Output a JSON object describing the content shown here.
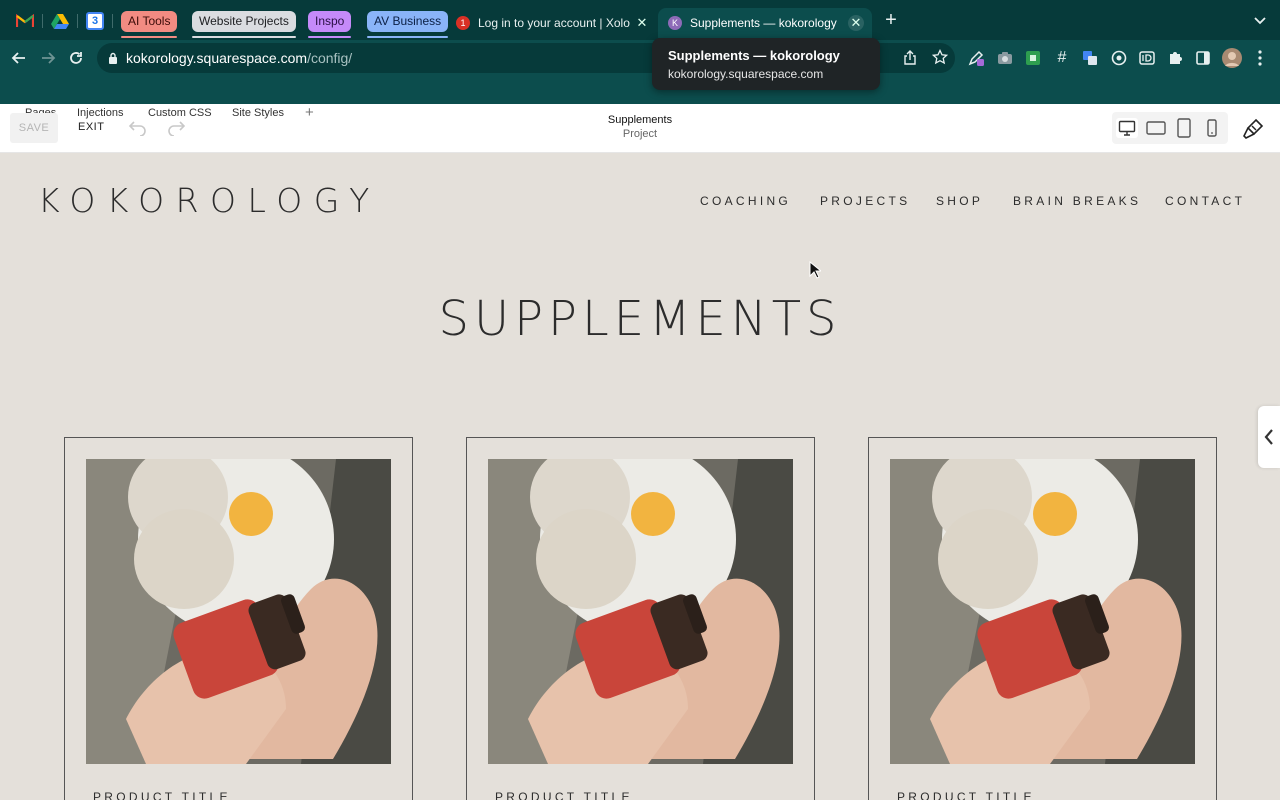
{
  "browser": {
    "pinned_tabs": [
      {
        "name": "gmail-icon",
        "glyph": "M",
        "color": "#ea4335"
      },
      {
        "name": "drive-icon",
        "glyph": "▲",
        "color": "#1fa463"
      },
      {
        "name": "calendar-icon",
        "glyph": "3",
        "color": "#4285f4"
      }
    ],
    "tab_groups": [
      {
        "label": "AI Tools",
        "color": "#f28b82",
        "text": "#3b0b08"
      },
      {
        "label": "Website Projects",
        "color": "#dadce0",
        "text": "#202124"
      },
      {
        "label": "Inspo",
        "color": "#c58af9",
        "text": "#2a0f44"
      },
      {
        "label": "AV Business",
        "color": "#8ab4f8",
        "text": "#0b1f44"
      }
    ],
    "tabs": [
      {
        "title": "Log in to your account | Xolo",
        "badge": "1"
      },
      {
        "title": "Supplements — kokorology",
        "active": true
      }
    ],
    "url_host": "kokorology.squarespace.com",
    "url_path": "/config/",
    "tooltip": {
      "title": "Supplements — kokorology",
      "host": "kokorology.squarespace.com"
    }
  },
  "editor": {
    "menu": [
      "Pages",
      "Injections",
      "Custom CSS",
      "Site Styles"
    ],
    "add_label": "+",
    "save_label": "SAVE",
    "exit_label": "EXIT",
    "page_name": "Supplements",
    "page_type": "Project"
  },
  "site": {
    "logo": "KOKOROLOGY",
    "nav": [
      "COACHING",
      "PROJECTS",
      "SHOP",
      "BRAIN BREAKS",
      "CONTACT"
    ],
    "page_title": "SUPPLEMENTS",
    "products": [
      {
        "title": "PRODUCT TITLE"
      },
      {
        "title": "PRODUCT TITLE"
      },
      {
        "title": "PRODUCT TITLE"
      }
    ]
  }
}
